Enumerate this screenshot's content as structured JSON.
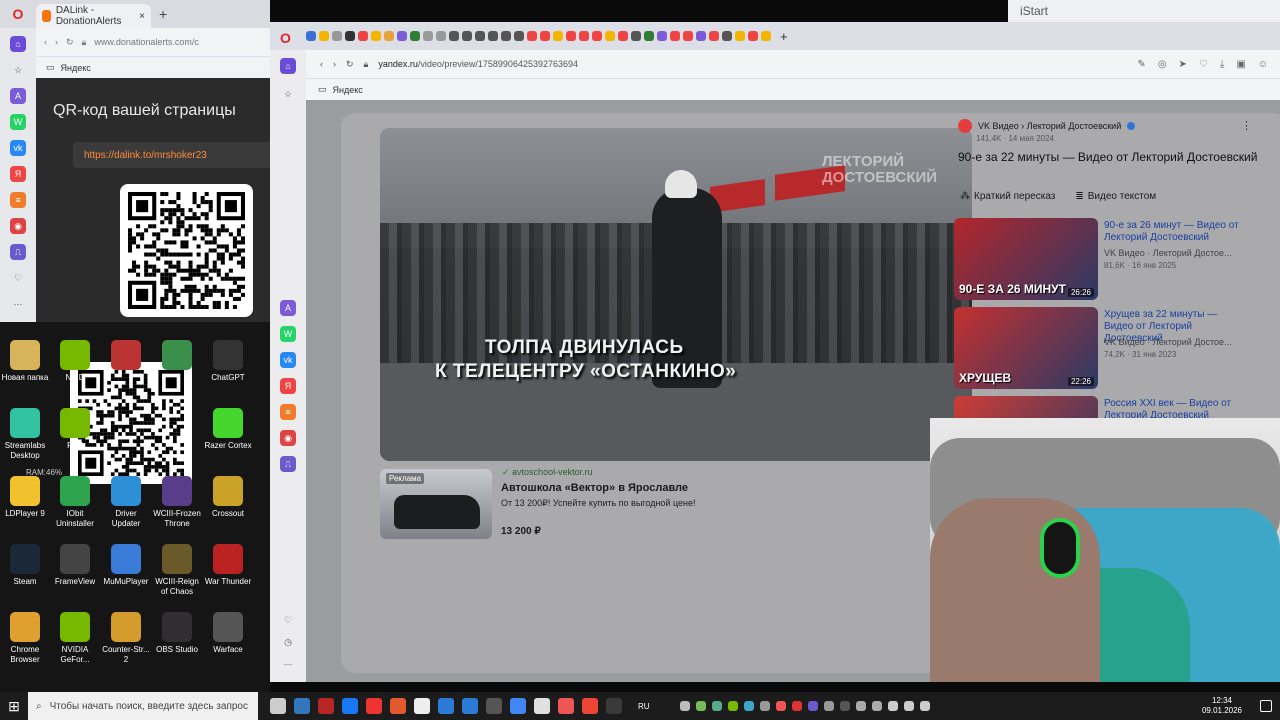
{
  "left_browser": {
    "tab_title": "DALink - DonationAlerts",
    "address": "www.donationalerts.com/c",
    "bookmark": "Яндекс",
    "qr_title": "QR-код вашей страницы",
    "link": "https://dalink.to/mrshoker23"
  },
  "desktop": {
    "icons": [
      {
        "label": "Новая папка",
        "color": "#d7b45a"
      },
      {
        "label": "NVID",
        "color": "#76b900"
      },
      {
        "label": "",
        "color": "#b33"
      },
      {
        "label": "",
        "color": "#3a8f4a"
      },
      {
        "label": "ChatGPT",
        "color": "#333"
      },
      {
        "label": "Streamlabs Desktop",
        "color": "#31c3a2"
      },
      {
        "label": "RTX",
        "color": "#76b900"
      },
      {
        "label": "Razer Cortex",
        "color": "#44d62c"
      },
      {
        "label": "LDPlayer 9",
        "color": "#f2c12e"
      },
      {
        "label": "IObit Uninstaller",
        "color": "#2ea44f"
      },
      {
        "label": "Driver Updater",
        "color": "#2f8fd6"
      },
      {
        "label": "WCIII-Frozen Throne",
        "color": "#5a3d8a"
      },
      {
        "label": "Crossout",
        "color": "#c9a227"
      },
      {
        "label": "Steam",
        "color": "#1b2838"
      },
      {
        "label": "FrameView",
        "color": "#444"
      },
      {
        "label": "MuMuPlayer",
        "color": "#3b7bd8"
      },
      {
        "label": "WCIII-Reign of Chaos",
        "color": "#6a5a2a"
      },
      {
        "label": "War Thunder",
        "color": "#b22"
      },
      {
        "label": "Chrome Browser",
        "color": "#e0a030"
      },
      {
        "label": "NVIDIA GeFor...",
        "color": "#76b900"
      },
      {
        "label": "Counter-Str... 2",
        "color": "#d39a2c"
      },
      {
        "label": "OBS Studio",
        "color": "#302e31"
      },
      {
        "label": "Warface",
        "color": "#555"
      }
    ],
    "ram": "RAM:46%"
  },
  "main_browser": {
    "url_host": "yandex.ru",
    "url_path": "/video/preview/17589906425392763694",
    "bookmark": "Яндекс"
  },
  "video": {
    "caption_line1": "ТОЛПА ДВИНУЛАСЬ",
    "caption_line2": "К ТЕЛЕЦЕНТРУ «ОСТАНКИНО»",
    "watermark_1": "ЛЕКТОРИЙ",
    "watermark_2": "ДОСТОЕВСКИЙ"
  },
  "ad": {
    "tag": "Реклама",
    "domain": "avtoschool-vektor.ru",
    "title": "Автошкола «Вектор» в Ярославле",
    "desc": "От 13 200₽! Успейте купить по выгодной цене!",
    "price": "13 200 ₽"
  },
  "info": {
    "channel": "VK Видео › Лекторий Достоевский",
    "views_date": "141,4K · 14 мая 2024",
    "title": "90-е за 22 минуты — Видео от Лекторий Достоевский",
    "chip_summary": "Краткий пересказ",
    "chip_text": "Видео текстом"
  },
  "recs": [
    {
      "title": "90-е за 26 минут — Видео от Лекторий Достоевский",
      "channel": "VK Видео · Лекторий Достое...",
      "meta": "81,6K · 16 янв 2025",
      "duration": "26:26",
      "thumb_text": "90-Е ЗА 26 МИНУТ",
      "thumb_color": "#b3262a"
    },
    {
      "title": "Хрущев за 22 минуты — Видео от Лекторий Достоевский",
      "channel": "VK Видео · Лекторий Достое...",
      "meta": "74,2K · 31 янв 2023",
      "duration": "22:26",
      "thumb_text": "ХРУЩЕВ",
      "thumb_color": "#c53030"
    },
    {
      "title": "Россия XXI век — Видео от Лекторий Достоевский",
      "channel": "",
      "meta": "",
      "duration": "",
      "thumb_text": "",
      "thumb_color": "#cf3b34"
    }
  ],
  "taskbar": {
    "search_placeholder": "Чтобы начать поиск, введите здесь запрос",
    "lang": "RU",
    "time": "12:34",
    "date": "09.01.2026"
  },
  "sliver_text": "iStart"
}
